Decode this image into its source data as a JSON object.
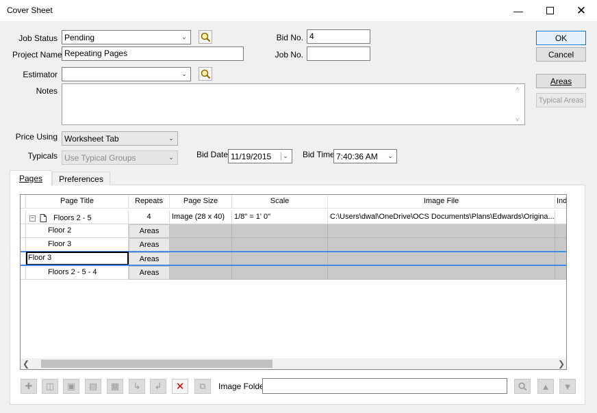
{
  "window": {
    "title": "Cover Sheet"
  },
  "fields": {
    "job_status_label": "Job Status",
    "job_status_value": "Pending",
    "project_name_label": "Project Name",
    "project_name_value": "Repeating Pages",
    "estimator_label": "Estimator",
    "estimator_value": "",
    "notes_label": "Notes",
    "bid_no_label": "Bid No.",
    "bid_no_value": "4",
    "job_no_label": "Job No.",
    "job_no_value": "",
    "price_using_label": "Price Using",
    "price_using_value": "Worksheet Tab",
    "typicals_label": "Typicals",
    "typicals_value": "Use Typical Groups",
    "bid_date_label": "Bid Date",
    "bid_date_value": "11/19/2015",
    "bid_time_label": "Bid Time",
    "bid_time_value": "7:40:36 AM"
  },
  "buttons": {
    "ok": "OK",
    "cancel": "Cancel",
    "areas": "Areas",
    "typical_areas": "Typical Areas"
  },
  "tabs": [
    {
      "label": "Pages"
    },
    {
      "label": "Preferences"
    }
  ],
  "grid": {
    "columns": [
      "Page Title",
      "Repeats",
      "Page Size",
      "Scale",
      "Image File",
      "Inde"
    ],
    "rows": [
      {
        "title": "Floors 2 - 5",
        "repeats": "4",
        "size": "Image (28 x 40)",
        "scale": "1/8\" = 1' 0\"",
        "image": "C:\\Users\\dwal\\OneDrive\\OCS Documents\\Plans\\Edwards\\Origina..."
      },
      {
        "title": "Floor 2",
        "repeats": "Areas"
      },
      {
        "title": "Floor 3",
        "repeats": "Areas"
      },
      {
        "title": "Floor 3",
        "repeats": "Areas"
      },
      {
        "title": "Floors 2 - 5 - 4",
        "repeats": "Areas"
      }
    ]
  },
  "bottom": {
    "image_folder_label": "Image Folder",
    "image_folder_value": ""
  }
}
